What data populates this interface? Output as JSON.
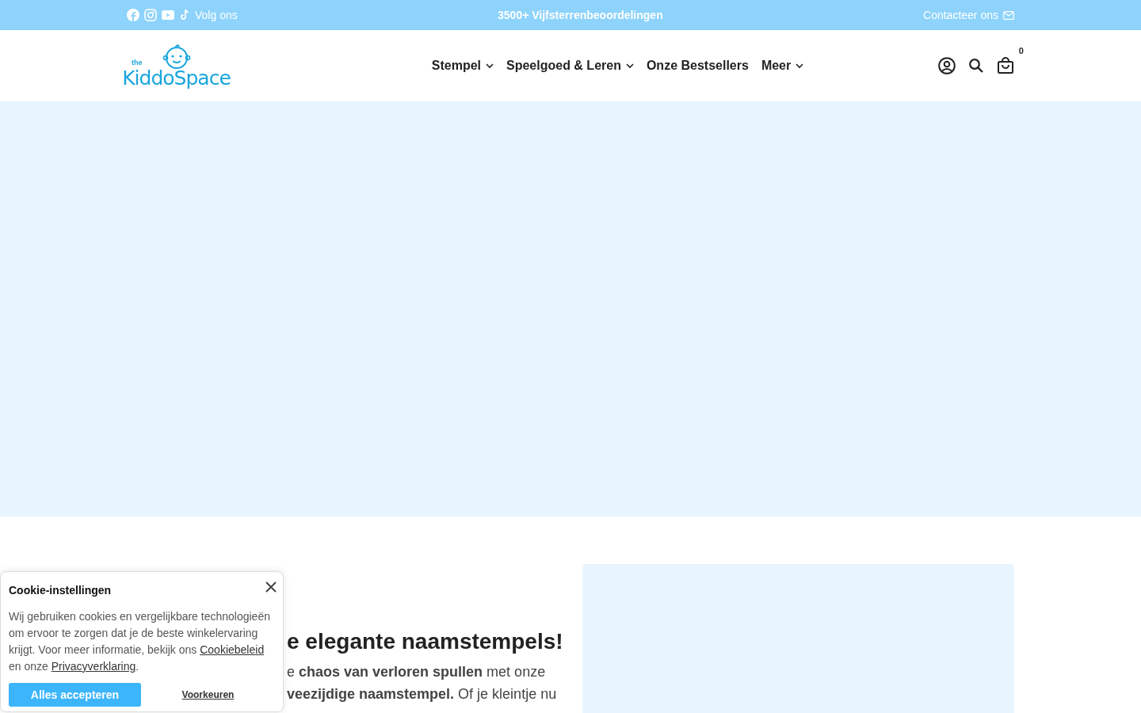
{
  "top_bar": {
    "follow_label": "Volg ons",
    "announcement": "3500+ Vijfsterrenbeoordelingen",
    "contact_label": "Contacteer ons"
  },
  "logo": {
    "small": "the",
    "name": "KiddoSpace"
  },
  "nav": [
    {
      "label": "Stempel",
      "has_menu": true
    },
    {
      "label": "Speelgoed & Leren",
      "has_menu": true
    },
    {
      "label": "Onze Bestsellers",
      "has_menu": false
    },
    {
      "label": "Meer",
      "has_menu": true
    }
  ],
  "cart": {
    "count": "0"
  },
  "feature": {
    "heading": "e elegante naamstempels!",
    "lines": [
      "e **chaos van verloren spullen** met onze",
      "**veezijdige naamstempel.** Of je kleintje nu"
    ]
  },
  "cookie": {
    "title": "Cookie-instellingen",
    "text_before": "Wij gebruiken cookies en vergelijkbare technologieën om ervoor te zorgen dat je de beste winkelervaring krijgt. Voor meer informatie, bekijk ons",
    "policy_link": "Cookiebeleid",
    "text_middle": "en onze",
    "privacy_link": "Privacyverklaring",
    "text_after": ".",
    "accept": "Alles accepteren",
    "preferences": "Voorkeuren"
  }
}
